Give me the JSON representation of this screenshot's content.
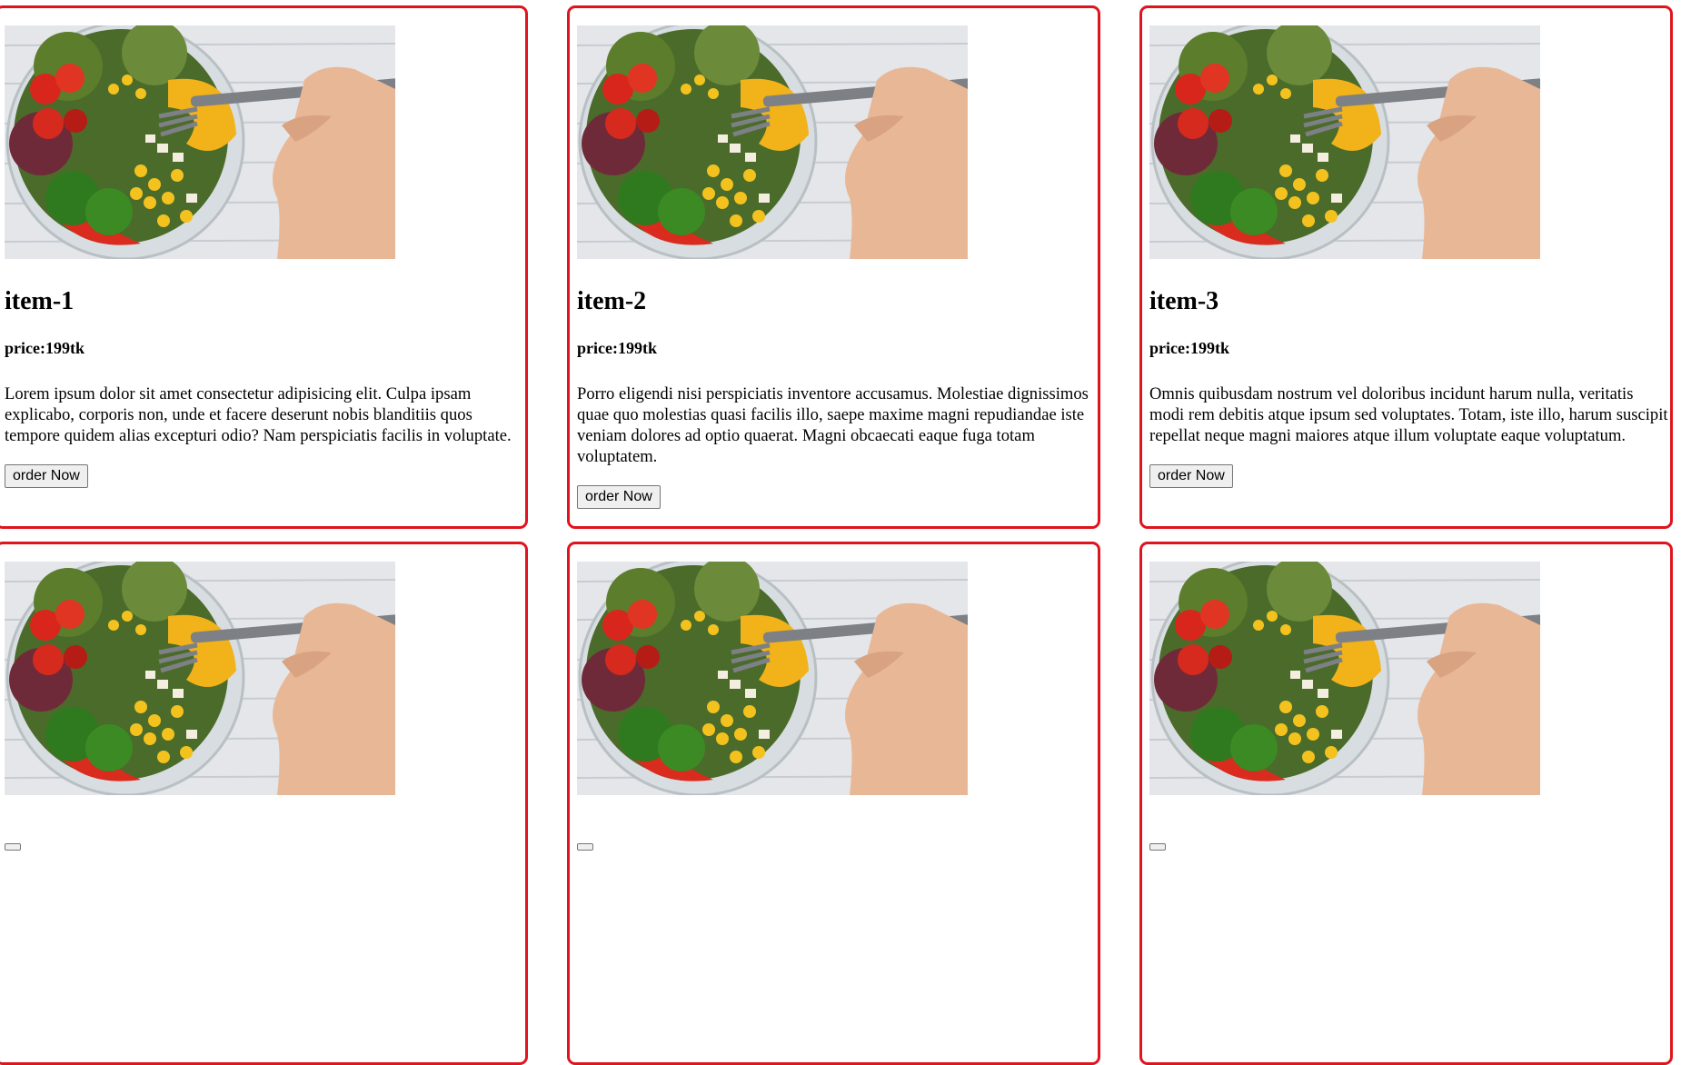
{
  "items": [
    {
      "title": "item-1",
      "price": "price:199tk",
      "description": "Lorem ipsum dolor sit amet consectetur adipisicing elit. Culpa ipsam explicabo, corporis non, unde et facere deserunt nobis blanditiis quos tempore quidem alias excepturi odio? Nam perspiciatis facilis in voluptate.",
      "button_label": "order Now"
    },
    {
      "title": "item-2",
      "price": "price:199tk",
      "description": "Porro eligendi nisi perspiciatis inventore accusamus. Molestiae dignissimos quae quo molestias quasi facilis illo, saepe maxime magni repudiandae iste veniam dolores ad optio quaerat. Magni obcaecati eaque fuga totam voluptatem.",
      "button_label": "order Now"
    },
    {
      "title": "item-3",
      "price": "price:199tk",
      "description": "Omnis quibusdam nostrum vel doloribus incidunt harum nulla, veritatis modi rem debitis atque ipsum sed voluptates. Totam, iste illo, harum suscipit repellat neque magni maiores atque illum voluptate eaque voluptatum.",
      "button_label": "order Now"
    },
    {
      "title": "",
      "price": "",
      "description": "",
      "button_label": ""
    },
    {
      "title": "",
      "price": "",
      "description": "",
      "button_label": ""
    },
    {
      "title": "",
      "price": "",
      "description": "",
      "button_label": ""
    }
  ],
  "colors": {
    "card_border": "#e0141e",
    "button_bg": "#efefef"
  }
}
